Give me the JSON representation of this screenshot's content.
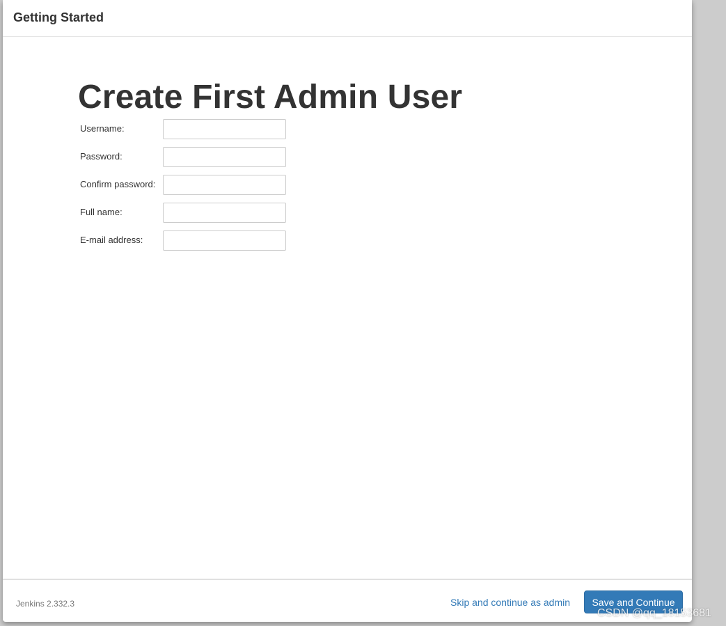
{
  "header": {
    "title": "Getting Started"
  },
  "main": {
    "heading": "Create First Admin User",
    "fields": [
      {
        "label": "Username:",
        "value": "",
        "placeholder": ""
      },
      {
        "label": "Password:",
        "value": "",
        "placeholder": ""
      },
      {
        "label": "Confirm password:",
        "value": "",
        "placeholder": ""
      },
      {
        "label": "Full name:",
        "value": "",
        "placeholder": ""
      },
      {
        "label": "E-mail address:",
        "value": "",
        "placeholder": ""
      }
    ]
  },
  "footer": {
    "version": "Jenkins 2.332.3",
    "skip_label": "Skip and continue as admin",
    "save_label": "Save and Continue"
  },
  "watermark": "CSDN @qq_18153681",
  "colors": {
    "primary": "#337ab7",
    "text": "#333333",
    "backdrop": "#cccccc"
  }
}
